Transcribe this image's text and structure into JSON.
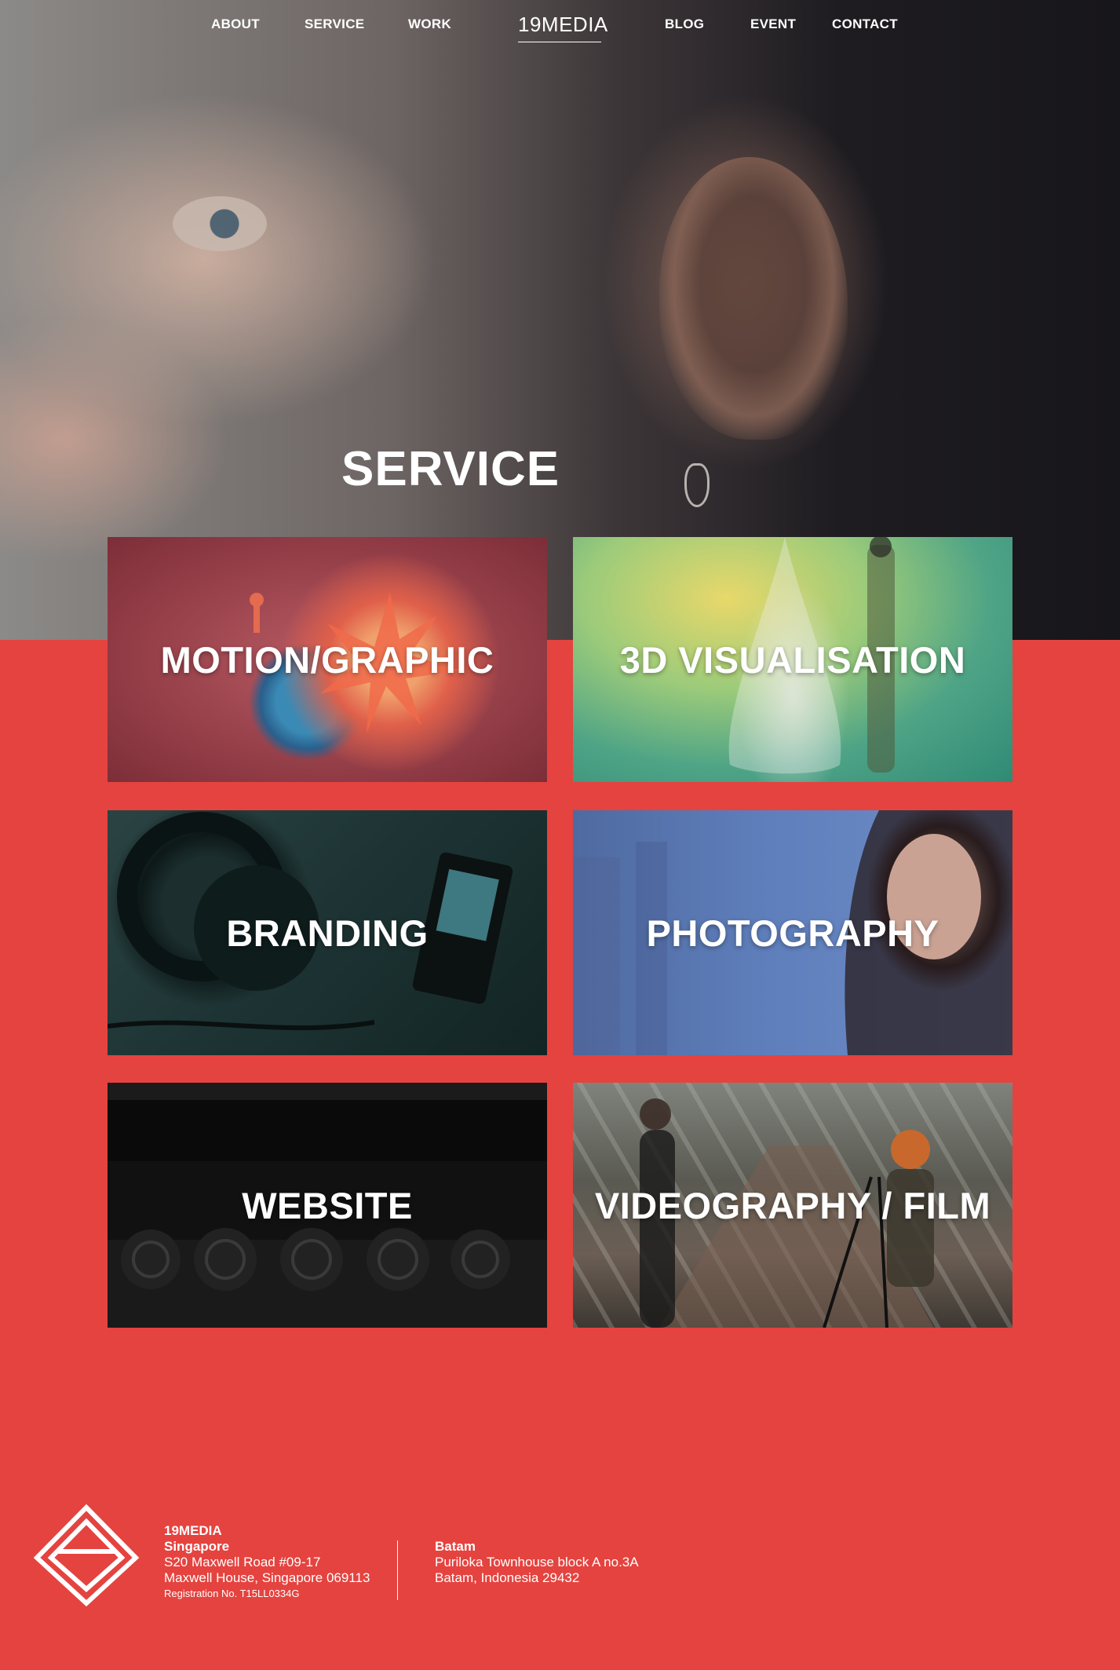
{
  "nav": {
    "left": [
      "ABOUT",
      "SERVICE",
      "WORK"
    ],
    "logo": "19MEDIA",
    "right": [
      "BLOG",
      "EVENT",
      "CONTACT"
    ]
  },
  "page_title": "SERVICE",
  "services": [
    "MOTION/GRAPHIC",
    "3D VISUALISATION",
    "BRANDING",
    "PHOTOGRAPHY",
    "WEBSITE",
    "VIDEOGRAPHY / FILM"
  ],
  "footer": {
    "company": "19MEDIA",
    "singapore": {
      "city": "Singapore",
      "line1": "S20 Maxwell Road #09-17",
      "line2": "Maxwell House, Singapore 069113",
      "registration": "Registration No. T15LL0334G"
    },
    "batam": {
      "city": "Batam",
      "line1": "Puriloka Townhouse block A no.3A",
      "line2": "Batam, Indonesia 29432"
    }
  },
  "colors": {
    "background": "#e5433f",
    "text": "#ffffff"
  }
}
